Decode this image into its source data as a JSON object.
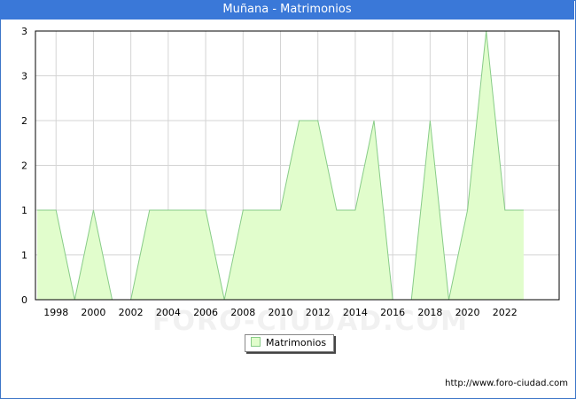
{
  "header": {
    "title": "Muñana - Matrimonios"
  },
  "source": "http://www.foro-ciudad.com",
  "watermark": "FORO-CIUDAD.COM",
  "legend": {
    "label": "Matrimonios"
  },
  "colors": {
    "title_bar": "#3a78d8",
    "area_fill": "#e1fdcc",
    "area_line": "#88cc88",
    "grid": "#d4d4d4"
  },
  "chart_data": {
    "type": "area",
    "x": [
      1997,
      1998,
      1999,
      2000,
      2001,
      2002,
      2003,
      2004,
      2005,
      2006,
      2007,
      2008,
      2009,
      2010,
      2011,
      2012,
      2013,
      2014,
      2015,
      2016,
      2017,
      2018,
      2019,
      2020,
      2021,
      2022,
      2023
    ],
    "series": [
      {
        "name": "Matrimonios",
        "values": [
          1,
          1,
          0,
          1,
          0,
          0,
          1,
          1,
          1,
          1,
          0,
          1,
          1,
          1,
          2,
          2,
          1,
          1,
          2,
          0,
          0,
          2,
          0,
          1,
          3,
          1,
          1
        ]
      }
    ],
    "x_ticks": [
      "1998",
      "2000",
      "2002",
      "2004",
      "2006",
      "2008",
      "2010",
      "2012",
      "2014",
      "2016",
      "2018",
      "2020",
      "2022"
    ],
    "y_ticks": [
      "0",
      "1",
      "1",
      "2",
      "2",
      "3",
      "3"
    ],
    "ylim": [
      0,
      3
    ],
    "grid": true,
    "legend_position": "bottom-center"
  }
}
